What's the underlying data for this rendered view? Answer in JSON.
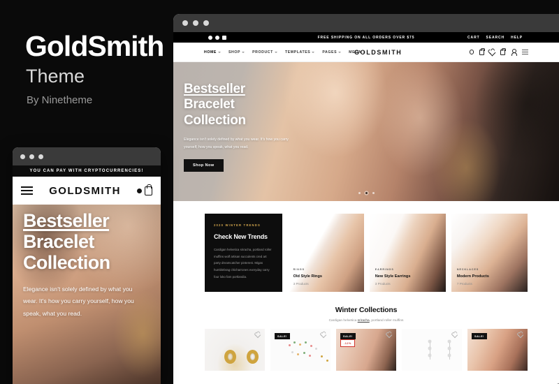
{
  "promo": {
    "title": "GoldSmith",
    "subtitle": "Theme",
    "author": "By Ninetheme"
  },
  "mobile": {
    "announcement": "YOU CAN PAY WITH CRYPTOCURRENCIES!",
    "logo": "GOLDSMITH",
    "hero": {
      "line1": "Bestseller",
      "line2": "Bracelet",
      "line3": "Collection",
      "paragraph": "Elegance isn't solely defined by what you wear. It's how you carry yourself, how you speak, what you read."
    }
  },
  "desktop": {
    "topbar": {
      "shipping": "FREE SHIPPING ON ALL ORDERS OVER $75",
      "links": [
        "CART",
        "SEARCH",
        "HELP"
      ]
    },
    "nav": {
      "items": [
        {
          "label": "HOME",
          "active": true
        },
        {
          "label": "SHOP",
          "active": false
        },
        {
          "label": "PRODUCT",
          "active": false
        },
        {
          "label": "TEMPLATES",
          "active": false
        },
        {
          "label": "PAGES",
          "active": false
        },
        {
          "label": "MEGA",
          "active": false
        }
      ],
      "logo": "GOLDSMITH"
    },
    "hero": {
      "line1": "Bestseller",
      "line2": "Bracelet",
      "line3": "Collection",
      "paragraph": "Elegance isn't solely defined by what you wear. It's how you carry yourself, how you speak, what you read.",
      "button": "Shop Now"
    },
    "trends_card": {
      "eyebrow": "2020 WINTER TRENDS",
      "title": "Check New Trends",
      "body": "Cardigan helvetica sriracha, portland roller muffins wolf artisan succulents cred art party dreamcatcher pinterest. Migas humblebrag chicharrones everyday carry four loko fam portlandia."
    },
    "categories": [
      {
        "eyebrow": "RINGS",
        "title": "Old Style Rings",
        "count": "3 Products"
      },
      {
        "eyebrow": "EARRINGS",
        "title": "New Style Earrings",
        "count": "3 Products"
      },
      {
        "eyebrow": "NECKLACES",
        "title": "Modern Products",
        "count": "7 Products"
      }
    ],
    "collections": {
      "title": "Winter Collections",
      "subtitle_pre": "Cardigan helvetica ",
      "subtitle_link": "sriracha",
      "subtitle_post": ", portland roller muffins"
    },
    "products": [
      {
        "badge": "",
        "badge2": ""
      },
      {
        "badge": "SALE!",
        "badge2": ""
      },
      {
        "badge": "SALE!",
        "badge2": "-12%"
      },
      {
        "badge": "",
        "badge2": ""
      },
      {
        "badge": "SALE!",
        "badge2": ""
      }
    ]
  },
  "colors": {
    "background": "#0a0a0a",
    "accent_gold": "#d6a94e",
    "sale_red": "#d0342c",
    "chrome": "#3a3a3a"
  }
}
